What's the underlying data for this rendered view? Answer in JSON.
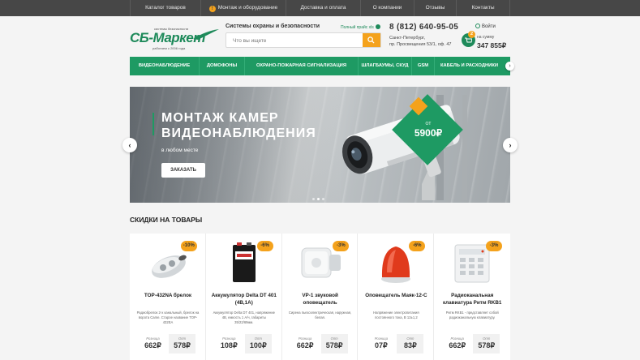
{
  "topnav": {
    "items": [
      "Каталог товаров",
      "Монтаж и оборудование",
      "Доставка и оплата",
      "О компании",
      "Отзывы",
      "Контакты"
    ],
    "badge": "!"
  },
  "header": {
    "logo_top": "системы безопасности",
    "logo_brand": "СБ-Маркет",
    "logo_bottom": "работаем с 2006 года",
    "tagline": "Системы охраны и безопасности",
    "price_link": "Полный прайс xls",
    "search_placeholder": "Что вы ищете",
    "phone": "8 (812) 640-95-05",
    "address_line1": "Санкт-Петербург,",
    "address_line2": "пр. Просвещения 53/1, оф. 47",
    "login": "Войти",
    "cart_count": "2",
    "cart_label": "на сумму",
    "cart_sum": "347 855₽"
  },
  "categories": [
    "ВИДЕОНАБЛЮДЕНИЕ",
    "ДОМОФОНЫ",
    "ОХРАНО-ПОЖАРНАЯ СИГНАЛИЗАЦИЯ",
    "ШЛАГБАУМЫ, СКУД",
    "GSM",
    "КАБЕЛЬ И РАСХОДНИКИ"
  ],
  "slider": {
    "title_line1": "МОНТАЖ КАМЕР",
    "title_line2": "ВИДЕОНАБЛЮДЕНИЯ",
    "subtitle": "в любом месте",
    "button": "ЗАКАЗАТЬ",
    "badge_from": "ОТ",
    "badge_price": "5900₽",
    "arrow_left": "‹",
    "arrow_right": "›"
  },
  "discounts": {
    "title": "СКИДКИ НА ТОВАРЫ",
    "retail_label": "Розница",
    "opt_label": "Опт",
    "products": [
      {
        "discount": "-10%",
        "name": "TOP-432NA брелок",
        "desc": "Радиобрелок 2-х канальный, брелок на ворота Came. Старое название TOP-432EA",
        "retail": "662₽",
        "opt": "578₽",
        "accent": "#c9ced2"
      },
      {
        "discount": "-6%",
        "name": "Аккумулятор Delta DT 401 (4В,1А)",
        "desc": "Аккумулятор Delta DT 401, напряжение 4В, емкость 1 А/ч, габариты 35/22/69мм.",
        "retail": "108₽",
        "opt": "100₽",
        "accent": "#1a1a1a"
      },
      {
        "discount": "-3%",
        "name": "VP-1 звуковой оповещатель",
        "desc": "Сирена пьезоэлектрическая, наружная, белая.",
        "retail": "662₽",
        "opt": "578₽",
        "accent": "#e9e9e9"
      },
      {
        "discount": "-6%",
        "name": "Оповещатель Маяк-12-С",
        "desc": "Напряжение электропитания постоянного тока, В 12±1,2",
        "retail": "07₽",
        "opt": "83₽",
        "accent": "#e03a1c"
      },
      {
        "discount": "-3%",
        "name": "Радиоканальная клавиатура Ритм RKB1",
        "desc": "Ритм RKB1 - представляет собой радиоканальную клавиатуру.",
        "retail": "662₽",
        "opt": "578₽",
        "accent": "#e6e8ea"
      }
    ]
  }
}
